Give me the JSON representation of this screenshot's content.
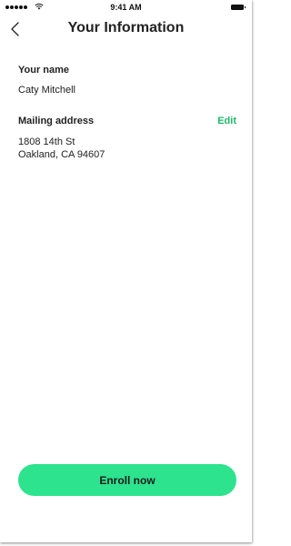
{
  "status_bar": {
    "time": "9:41 AM"
  },
  "header": {
    "title": "Your Information",
    "back_icon": "chevron-left-icon"
  },
  "name_section": {
    "label": "Your name",
    "value": "Caty Mitchell"
  },
  "address_section": {
    "label": "Mailing address",
    "edit_label": "Edit",
    "line1": "1808 14th St",
    "line2": "Oakland, CA 94607"
  },
  "footer": {
    "enroll_label": "Enroll now"
  },
  "colors": {
    "accent": "#2de38e",
    "link": "#1fb86b"
  }
}
